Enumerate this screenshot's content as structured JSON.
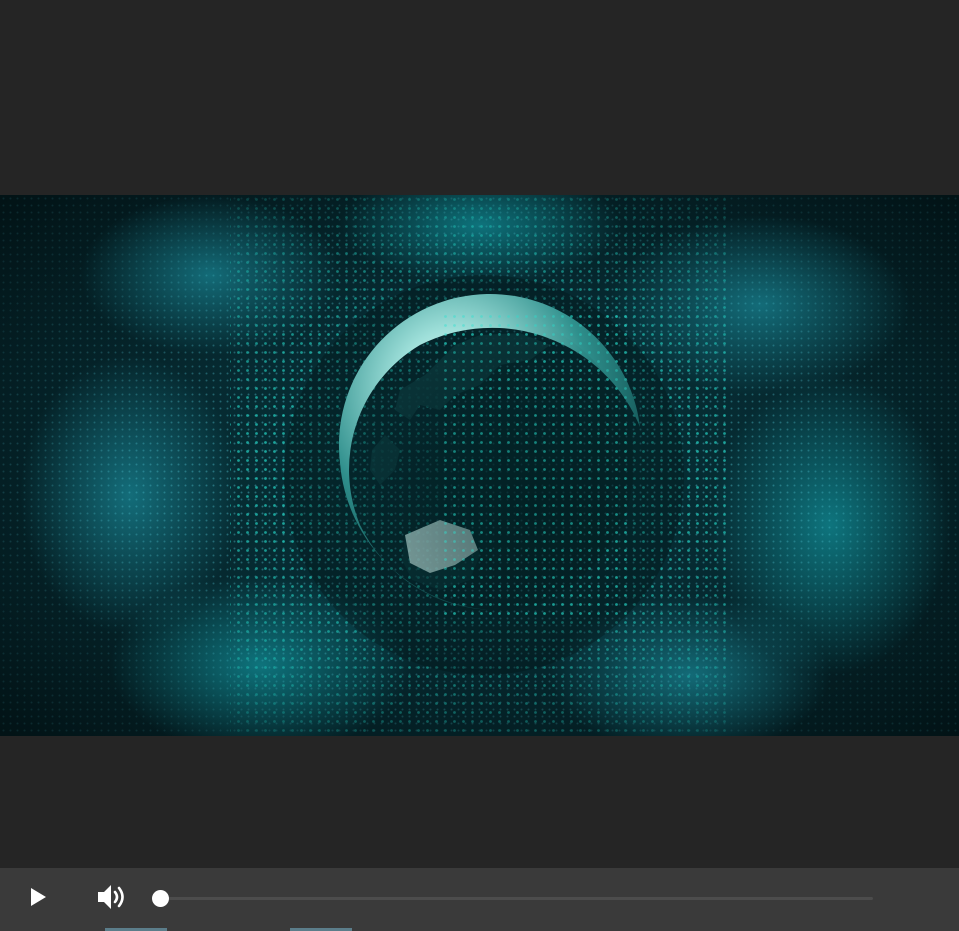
{
  "video": {
    "content_icon": "globe-icon",
    "accent_color": "#1fd6c9",
    "background_color": "#02161a"
  },
  "controls": {
    "play_icon": "play-icon",
    "volume_icon": "volume-icon",
    "progress_fraction": 0.0,
    "bar_color": "#3a3a3a",
    "handle_color": "#ffffff"
  },
  "page": {
    "background_color": "#252525"
  }
}
